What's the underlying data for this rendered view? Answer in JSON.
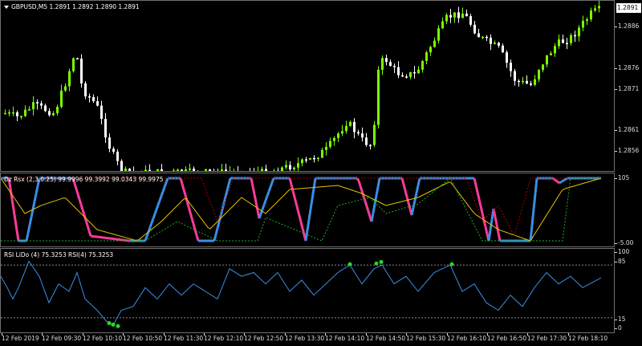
{
  "main": {
    "title": "GBPUSD,M5  1.2891 1.2892 1.2890 1.2891",
    "current_price": "1.2891",
    "ticks": [
      "1.2886",
      "1.2876",
      "1.2871",
      "1.2861",
      "1.2856"
    ],
    "colors": {
      "bull": "#7CFC00",
      "bear": "#FFFFFF",
      "background": "#000000"
    }
  },
  "osc": {
    "title": "Dz Rsx (2,3,0.25) 99.9996 99.3992 99.0343 99.9975",
    "ticks": [
      "105",
      "-5.00"
    ],
    "colors": {
      "up": "#3a8ee6",
      "down": "#ff3a9a",
      "slow": "#e6c000",
      "upper_band": "#b00000",
      "lower_band": "#1eb01e"
    }
  },
  "rsi": {
    "title": "RSI LiDo (4) 75.3253  RSI(4) 75.3253",
    "ticks": [
      "100",
      "85",
      "15",
      "0"
    ],
    "levels": [
      85,
      15
    ],
    "colors": {
      "line": "#3a8ee6",
      "signal": "#22dd22"
    }
  },
  "time_axis": {
    "labels": [
      "12 Feb 2019",
      "12 Feb 09:30",
      "12 Feb 10:10",
      "12 Feb 10:50",
      "12 Feb 11:30",
      "12 Feb 12:10",
      "12 Feb 12:50",
      "12 Feb 13:30",
      "12 Feb 14:10",
      "12 Feb 14:50",
      "12 Feb 15:30",
      "12 Feb 16:10",
      "12 Feb 16:50",
      "12 Feb 17:30",
      "12 Feb 18:10"
    ]
  }
}
